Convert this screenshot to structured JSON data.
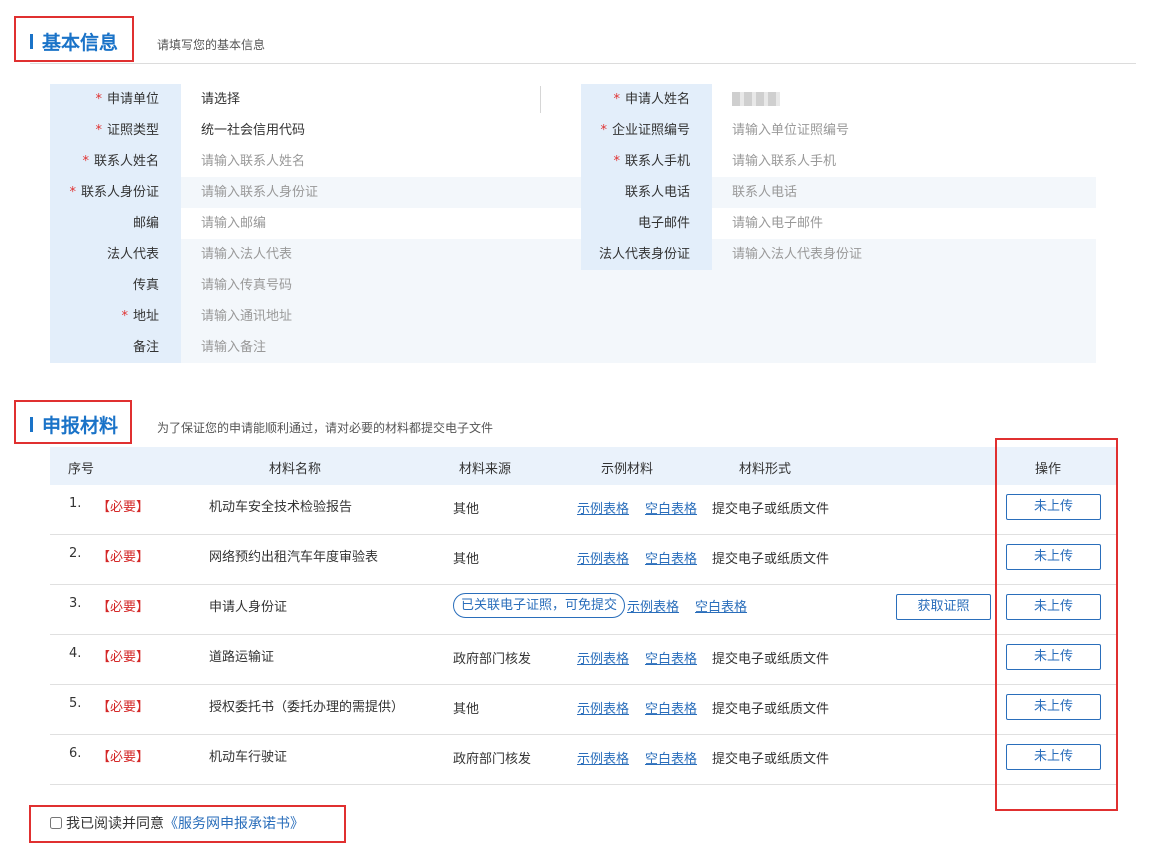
{
  "basic": {
    "title": "基本信息",
    "subtitle": "请填写您的基本信息",
    "rows": [
      {
        "l_label": "申请单位",
        "l_req": true,
        "l_value": "请选择",
        "l_filled": true,
        "r_label": "申请人姓名",
        "r_req": true,
        "r_value": "",
        "r_blurred": true
      },
      {
        "l_label": "证照类型",
        "l_req": true,
        "l_value": "统一社会信用代码",
        "l_filled": true,
        "r_label": "企业证照编号",
        "r_req": true,
        "r_value": "请输入单位证照编号"
      },
      {
        "l_label": "联系人姓名",
        "l_req": true,
        "l_value": "请输入联系人姓名",
        "r_label": "联系人手机",
        "r_req": true,
        "r_value": "请输入联系人手机"
      },
      {
        "l_label": "联系人身份证",
        "l_req": true,
        "l_value": "请输入联系人身份证",
        "r_label": "联系人电话",
        "r_req": false,
        "r_value": "联系人电话"
      },
      {
        "l_label": "邮编",
        "l_req": false,
        "l_value": "请输入邮编",
        "r_label": "电子邮件",
        "r_req": false,
        "r_value": "请输入电子邮件"
      },
      {
        "l_label": "法人代表",
        "l_req": false,
        "l_value": "请输入法人代表",
        "r_label": "法人代表身份证",
        "r_req": false,
        "r_value": "请输入法人代表身份证"
      },
      {
        "l_label": "传真",
        "l_req": false,
        "l_value": "请输入传真号码"
      },
      {
        "l_label": "地址",
        "l_req": true,
        "l_value": "请输入通讯地址"
      },
      {
        "l_label": "备注",
        "l_req": false,
        "l_value": "请输入备注"
      }
    ]
  },
  "materials": {
    "title": "申报材料",
    "subtitle": "为了保证您的申请能顺利通过，请对必要的材料都提交电子文件",
    "columns": {
      "no": "序号",
      "name": "材料名称",
      "source": "材料来源",
      "example": "示例材料",
      "form": "材料形式",
      "action": "操作"
    },
    "must_label": "【必要】",
    "example_link": "示例表格",
    "blank_link": "空白表格",
    "upload_label": "未上传",
    "rows": [
      {
        "no": "1.",
        "name": "机动车安全技术检验报告",
        "source": "其他",
        "form": "提交电子或纸质文件"
      },
      {
        "no": "2.",
        "name": "网络预约出租汽车年度审验表",
        "source": "其他",
        "form": "提交电子或纸质文件"
      },
      {
        "no": "3.",
        "name": "申请人身份证",
        "source": "",
        "tag": "已关联电子证照，可免提交",
        "form": "",
        "cert_button": "获取证照"
      },
      {
        "no": "4.",
        "name": "道路运输证",
        "source": "政府部门核发",
        "form": "提交电子或纸质文件"
      },
      {
        "no": "5.",
        "name": "授权委托书（委托办理的需提供）",
        "source": "其他",
        "form": "提交电子或纸质文件"
      },
      {
        "no": "6.",
        "name": "机动车行驶证",
        "source": "政府部门核发",
        "form": "提交电子或纸质文件"
      }
    ]
  },
  "agreement": {
    "prefix": "我已阅读并同意",
    "link": "《服务网申报承诺书》"
  },
  "colors": {
    "accent": "#1a73c8",
    "required": "#e03030",
    "label_bg": "#e3eefa",
    "highlight": "#e03030"
  }
}
